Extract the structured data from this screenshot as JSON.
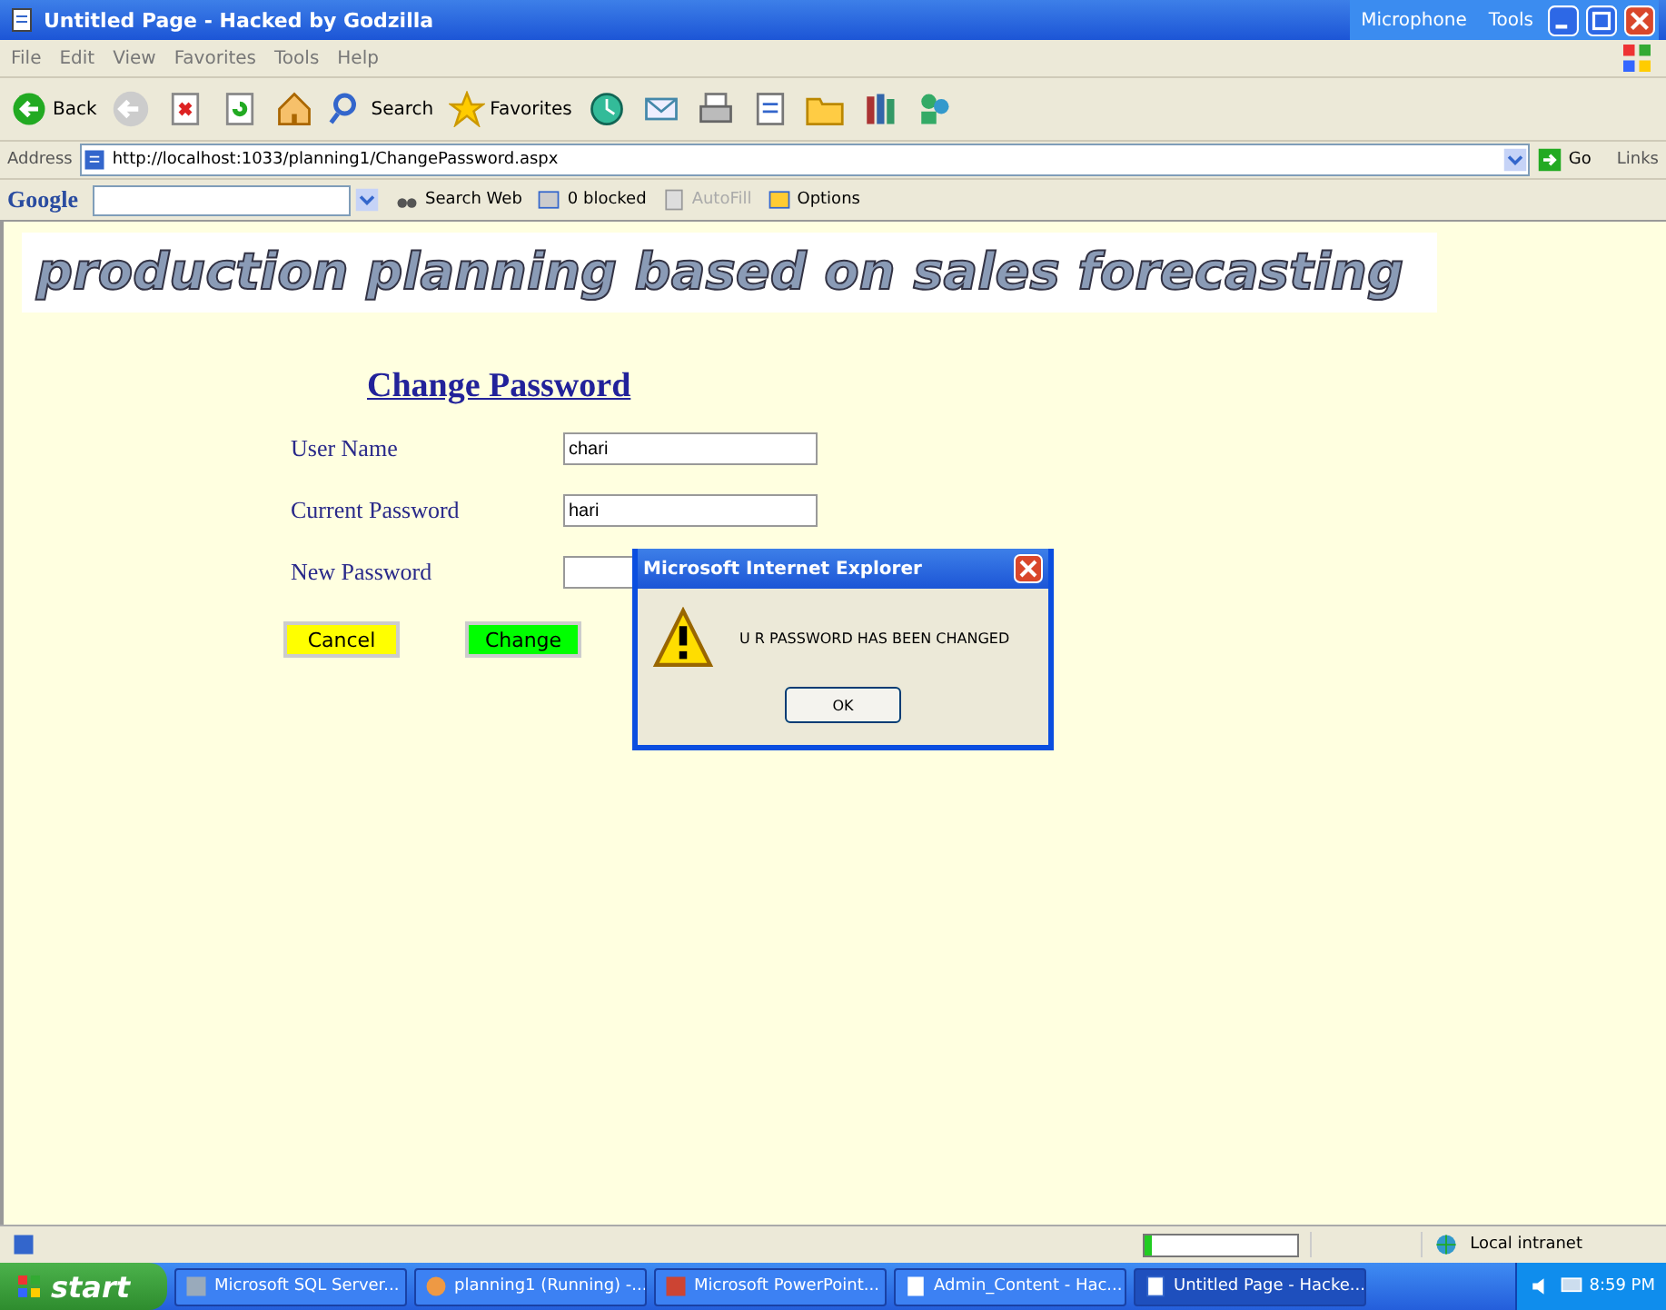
{
  "window": {
    "title": "Untitled Page - Hacked by Godzilla",
    "tools": [
      "Microphone",
      "Tools"
    ]
  },
  "menu": [
    "File",
    "Edit",
    "View",
    "Favorites",
    "Tools",
    "Help"
  ],
  "toolbar": [
    {
      "kind": "labeled",
      "label": "Back"
    },
    {
      "kind": "icon"
    },
    {
      "kind": "icon"
    },
    {
      "kind": "icon"
    },
    {
      "kind": "icon"
    },
    {
      "kind": "labeled",
      "label": "Search"
    },
    {
      "kind": "labeled",
      "label": "Favorites"
    },
    {
      "kind": "icon"
    },
    {
      "kind": "icon"
    },
    {
      "kind": "icon"
    },
    {
      "kind": "icon"
    },
    {
      "kind": "icon"
    },
    {
      "kind": "icon"
    },
    {
      "kind": "icon"
    }
  ],
  "address": {
    "label": "Address",
    "value": "http://localhost:1033/planning1/ChangePassword.aspx",
    "go": "Go",
    "links": "Links"
  },
  "google_bar": {
    "logo": "Google",
    "items": [
      {
        "label": "Search Web",
        "disabled": false
      },
      {
        "label": "0 blocked",
        "disabled": false
      },
      {
        "label": "AutoFill",
        "disabled": true
      },
      {
        "label": "Options",
        "disabled": false
      }
    ]
  },
  "page": {
    "banner": "production planning based on sales forecasting",
    "heading": "Change Password",
    "fields": [
      {
        "label": "User Name",
        "value": "chari"
      },
      {
        "label": "Current Password",
        "value": "hari"
      },
      {
        "label": "New Password"
      }
    ],
    "buttons": [
      {
        "label": "Cancel",
        "color": "#ffff00"
      },
      {
        "label": "Change",
        "color": "#00ff00"
      }
    ]
  },
  "dialog": {
    "title": "Microsoft Internet Explorer",
    "message": "U R PASSWORD HAS BEEN CHANGED",
    "ok": "OK"
  },
  "status_bar": {
    "progress": {
      "level": 0.05
    },
    "zone": "Local intranet"
  },
  "taskbar": {
    "start": "start",
    "tasks": [
      {
        "label": "Microsoft SQL Server...",
        "selected": false
      },
      {
        "label": "planning1 (Running) -...",
        "selected": false
      },
      {
        "label": "Microsoft PowerPoint...",
        "selected": false
      },
      {
        "label": "Admin_Content - Hac...",
        "selected": false
      },
      {
        "label": "Untitled Page - Hacke...",
        "selected": true
      }
    ],
    "clock": "8:59 PM"
  }
}
